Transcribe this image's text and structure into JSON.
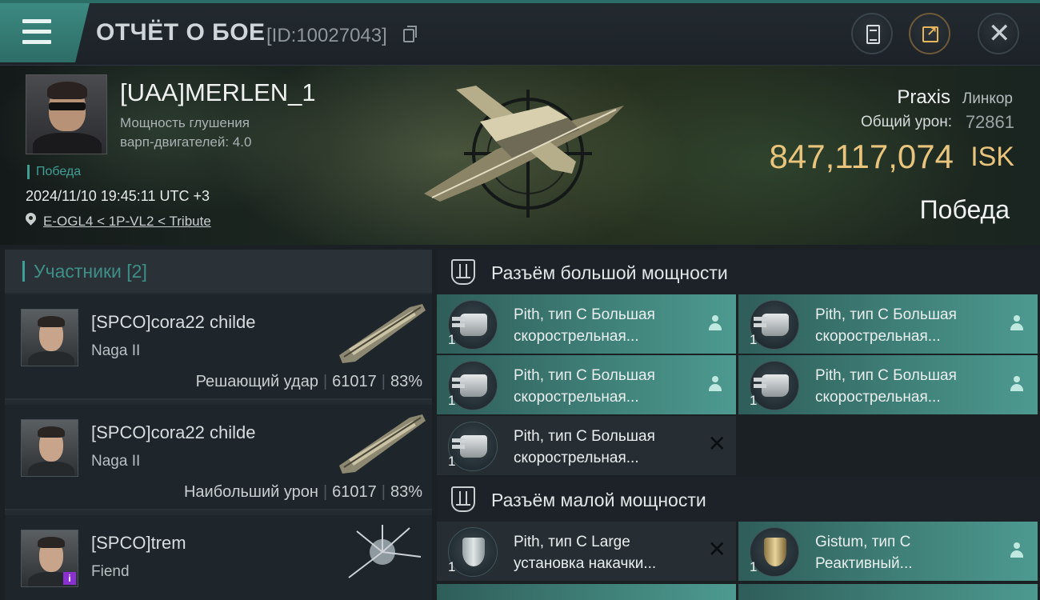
{
  "header": {
    "title": "ОТЧЁТ О БОЕ",
    "report_id": "[ID:10027043]"
  },
  "victim": {
    "pilot": "[UAA]MERLEN_1",
    "stat_line1": "Мощность глушения",
    "stat_line2": "варп-двигателей: 4.0",
    "tag": "Победа",
    "timestamp": "2024/11/10 19:45:11 UTC +3",
    "location": "E-OGL4 < 1P-VL2 < Tribute",
    "ship_name": "Praxis",
    "ship_class": "Линкор",
    "damage_label": "Общий урон:",
    "damage_value": "72861",
    "isk_value": "847,117,074",
    "isk_unit": "ISK",
    "result": "Победа"
  },
  "participants": {
    "title": "Участники [2]",
    "items": [
      {
        "name": "[SPCO]cora22 childe",
        "ship": "Naga II",
        "role": "Решающий удар",
        "damage": "61017",
        "percent": "83%"
      },
      {
        "name": "[SPCO]cora22 childe",
        "ship": "Naga II",
        "role": "Наибольший урон",
        "damage": "61017",
        "percent": "83%"
      },
      {
        "name": "[SPCO]trem",
        "ship": "Fiend",
        "badge": "i"
      }
    ]
  },
  "slots": {
    "high": {
      "title": "Разъём большой мощности",
      "modules": [
        {
          "line1": "Pith, тип C Большая",
          "line2": "скорострельная...",
          "count": "1",
          "status": "dropped"
        },
        {
          "line1": "Pith, тип C Большая",
          "line2": "скорострельная...",
          "count": "1",
          "status": "dropped"
        },
        {
          "line1": "Pith, тип C Большая",
          "line2": "скорострельная...",
          "count": "1",
          "status": "dropped"
        },
        {
          "line1": "Pith, тип C Большая",
          "line2": "скорострельная...",
          "count": "1",
          "status": "dropped"
        },
        {
          "line1": "Pith, тип C Большая",
          "line2": "скорострельная...",
          "count": "1",
          "status": "destroyed"
        }
      ]
    },
    "mid": {
      "title": "Разъём малой мощности",
      "modules": [
        {
          "line1": "Pith, тип C Large",
          "line2": "установка накачки...",
          "count": "1",
          "status": "destroyed"
        },
        {
          "line1": "Gistum, тип C",
          "line2": "Реактивный...",
          "count": "1",
          "status": "dropped"
        }
      ]
    }
  },
  "colors": {
    "accent": "#3f9f94",
    "isk": "#e9c47c",
    "module_dropped": "#3f8078",
    "module_destroyed": "#262e34"
  }
}
